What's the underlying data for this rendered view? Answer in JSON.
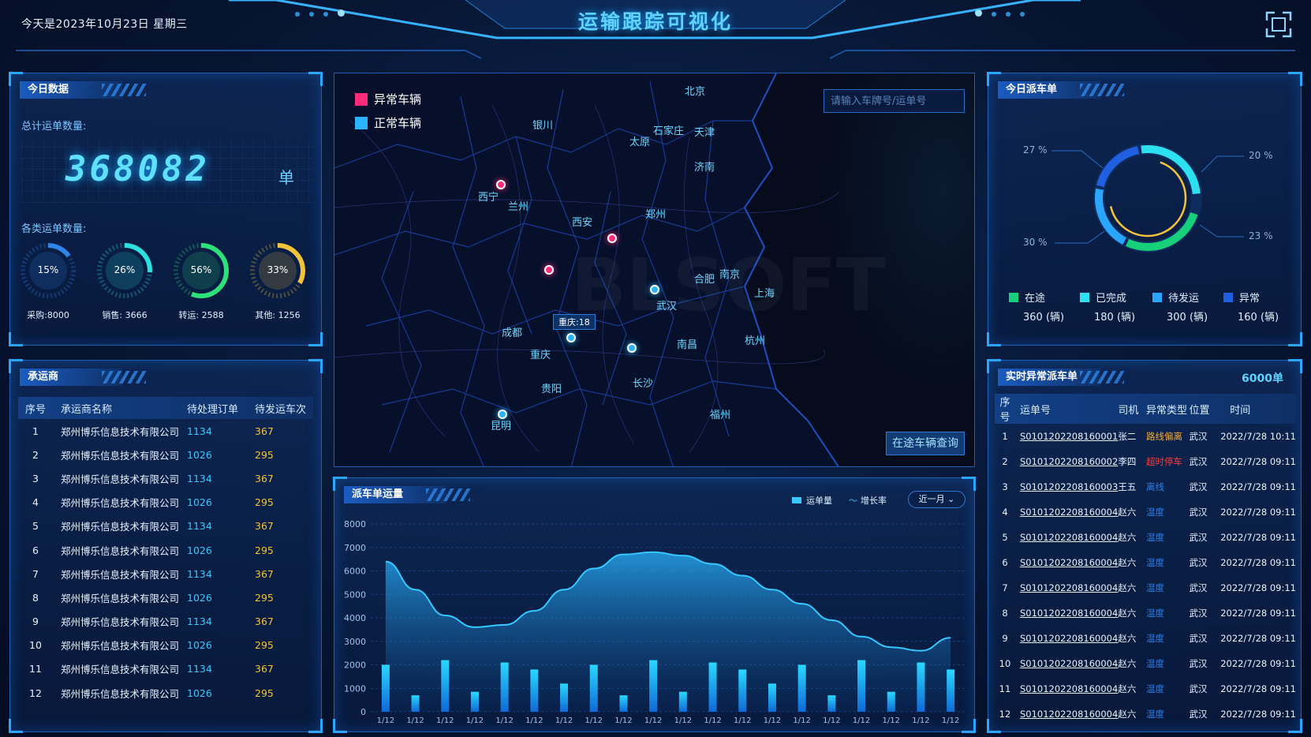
{
  "header": {
    "date_text": "今天是2023年10月23日 星期三",
    "title": "运输跟踪可视化"
  },
  "today": {
    "panel_title": "今日数据",
    "total_label": "总计运单数量:",
    "total_value": "368082",
    "total_unit": "单",
    "category_label": "各类运单数量:",
    "rings": [
      {
        "pct": "15%",
        "value": 0.15,
        "label": "采购:8000",
        "color": "#2f86e8"
      },
      {
        "pct": "26%",
        "value": 0.26,
        "label": "销售: 3666",
        "color": "#2de0e0"
      },
      {
        "pct": "56%",
        "value": 0.56,
        "label": "转运: 2588",
        "color": "#2de07a"
      },
      {
        "pct": "33%",
        "value": 0.33,
        "label": "其他: 1256",
        "color": "#f3c33b"
      }
    ]
  },
  "carriers": {
    "panel_title": "承运商",
    "headers": [
      "序号",
      "承运商名称",
      "待处理订单",
      "待发运车次"
    ],
    "rows": [
      {
        "idx": "1",
        "name": "郑州博乐信息技术有限公司",
        "orders": "1134",
        "trips": "367"
      },
      {
        "idx": "2",
        "name": "郑州博乐信息技术有限公司",
        "orders": "1026",
        "trips": "295"
      },
      {
        "idx": "3",
        "name": "郑州博乐信息技术有限公司",
        "orders": "1134",
        "trips": "367"
      },
      {
        "idx": "4",
        "name": "郑州博乐信息技术有限公司",
        "orders": "1026",
        "trips": "295"
      },
      {
        "idx": "5",
        "name": "郑州博乐信息技术有限公司",
        "orders": "1134",
        "trips": "367"
      },
      {
        "idx": "6",
        "name": "郑州博乐信息技术有限公司",
        "orders": "1026",
        "trips": "295"
      },
      {
        "idx": "7",
        "name": "郑州博乐信息技术有限公司",
        "orders": "1134",
        "trips": "367"
      },
      {
        "idx": "8",
        "name": "郑州博乐信息技术有限公司",
        "orders": "1026",
        "trips": "295"
      },
      {
        "idx": "9",
        "name": "郑州博乐信息技术有限公司",
        "orders": "1134",
        "trips": "367"
      },
      {
        "idx": "10",
        "name": "郑州博乐信息技术有限公司",
        "orders": "1026",
        "trips": "295"
      },
      {
        "idx": "11",
        "name": "郑州博乐信息技术有限公司",
        "orders": "1134",
        "trips": "367"
      },
      {
        "idx": "12",
        "name": "郑州博乐信息技术有限公司",
        "orders": "1026",
        "trips": "295"
      }
    ]
  },
  "map": {
    "legend_abnormal": "异常车辆",
    "legend_normal": "正常车辆",
    "abnormal_color": "#ff2a7a",
    "normal_color": "#2ab4ff",
    "search_placeholder": "请输入车牌号/运单号",
    "query_button": "在途车辆查询",
    "tag": "重庆:18",
    "cities": [
      "北京",
      "银川",
      "太原",
      "石家庄",
      "天津",
      "济南",
      "西宁",
      "兰州",
      "西安",
      "郑州",
      "合肥",
      "南京",
      "上海",
      "武汉",
      "成都",
      "重庆",
      "南昌",
      "杭州",
      "长沙",
      "贵阳",
      "福州",
      "昆明"
    ]
  },
  "dispatch": {
    "panel_title": "今日派车单",
    "pct_labels": [
      "27 %",
      "20 %",
      "30 %",
      "23 %"
    ],
    "items": [
      {
        "label": "在途",
        "value": "360 (辆)",
        "color": "#18d07a"
      },
      {
        "label": "已完成",
        "value": "180 (辆)",
        "color": "#2de0f0"
      },
      {
        "label": "待发运",
        "value": "300 (辆)",
        "color": "#2aa6ff"
      },
      {
        "label": "异常",
        "value": "160 (辆)",
        "color": "#1f5fe0"
      }
    ]
  },
  "exceptions": {
    "panel_title": "实时异常派车单",
    "count": "6000单",
    "headers": [
      "序号",
      "运单号",
      "司机",
      "异常类型",
      "位置",
      "时间"
    ],
    "rows": [
      {
        "idx": "1",
        "no": "S0101202208160001",
        "driver": "张二",
        "type": "路线偏离",
        "type_cls": "tag-orange",
        "loc": "武汉",
        "time": "2022/7/28 10:11"
      },
      {
        "idx": "2",
        "no": "S0101202208160002",
        "driver": "李四",
        "type": "超时停车",
        "type_cls": "tag-red",
        "loc": "武汉",
        "time": "2022/7/28 09:11"
      },
      {
        "idx": "3",
        "no": "S0101202208160003",
        "driver": "王五",
        "type": "离线",
        "type_cls": "tag-blue",
        "loc": "武汉",
        "time": "2022/7/28 09:11"
      },
      {
        "idx": "4",
        "no": "S0101202208160004",
        "driver": "赵六",
        "type": "温度",
        "type_cls": "tag-blue",
        "loc": "武汉",
        "time": "2022/7/28 09:11"
      },
      {
        "idx": "5",
        "no": "S0101202208160004",
        "driver": "赵六",
        "type": "温度",
        "type_cls": "tag-blue",
        "loc": "武汉",
        "time": "2022/7/28 09:11"
      },
      {
        "idx": "6",
        "no": "S0101202208160004",
        "driver": "赵六",
        "type": "温度",
        "type_cls": "tag-blue",
        "loc": "武汉",
        "time": "2022/7/28 09:11"
      },
      {
        "idx": "7",
        "no": "S0101202208160004",
        "driver": "赵六",
        "type": "温度",
        "type_cls": "tag-blue",
        "loc": "武汉",
        "time": "2022/7/28 09:11"
      },
      {
        "idx": "8",
        "no": "S0101202208160004",
        "driver": "赵六",
        "type": "温度",
        "type_cls": "tag-blue",
        "loc": "武汉",
        "time": "2022/7/28 09:11"
      },
      {
        "idx": "9",
        "no": "S0101202208160004",
        "driver": "赵六",
        "type": "温度",
        "type_cls": "tag-blue",
        "loc": "武汉",
        "time": "2022/7/28 09:11"
      },
      {
        "idx": "10",
        "no": "S0101202208160004",
        "driver": "赵六",
        "type": "温度",
        "type_cls": "tag-blue",
        "loc": "武汉",
        "time": "2022/7/28 09:11"
      },
      {
        "idx": "11",
        "no": "S0101202208160004",
        "driver": "赵六",
        "type": "温度",
        "type_cls": "tag-blue",
        "loc": "武汉",
        "time": "2022/7/28 09:11"
      },
      {
        "idx": "12",
        "no": "S0101202208160004",
        "driver": "赵六",
        "type": "温度",
        "type_cls": "tag-blue",
        "loc": "武汉",
        "time": "2022/7/28 09:11"
      }
    ]
  },
  "volume": {
    "panel_title": "派车单运量",
    "legend_bar": "运单量",
    "legend_line": "增长率",
    "range_select": "近一月"
  },
  "chart_data": {
    "type": "bar",
    "categories": [
      "1/12",
      "1/12",
      "1/12",
      "1/12",
      "1/12",
      "1/12",
      "1/12",
      "1/12",
      "1/12",
      "1/12",
      "1/12",
      "1/12",
      "1/12",
      "1/12",
      "1/12",
      "1/12",
      "1/12",
      "1/12",
      "1/12",
      "1/12"
    ],
    "series": [
      {
        "name": "运单量",
        "type": "bar",
        "values": [
          2000,
          700,
          2200,
          850,
          2100,
          1800,
          1200,
          2000,
          700,
          2200,
          850,
          2100,
          1800,
          1200,
          2000,
          700,
          2200,
          850,
          2100,
          1800
        ]
      },
      {
        "name": "增长率",
        "type": "area",
        "values": [
          6400,
          5200,
          4100,
          3600,
          3700,
          4300,
          5200,
          6100,
          6700,
          6800,
          6650,
          6300,
          5800,
          5200,
          4600,
          3900,
          3200,
          2750,
          2600,
          3150
        ]
      }
    ],
    "ylim": [
      0,
      8000
    ],
    "yticks": [
      0,
      1000,
      2000,
      3000,
      4000,
      5000,
      6000,
      7000,
      8000
    ],
    "grid": true,
    "legend_position": "top-right"
  }
}
